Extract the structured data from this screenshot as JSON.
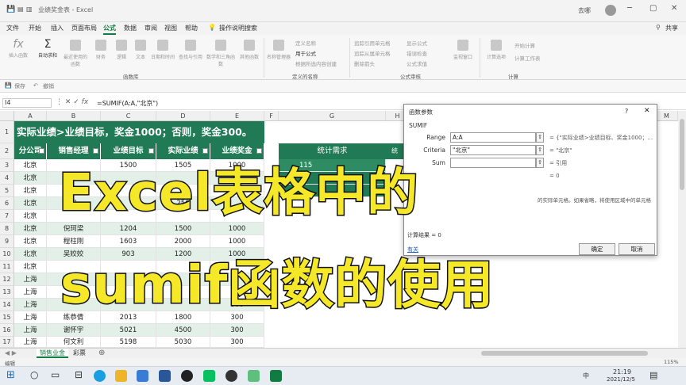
{
  "titlebar": {
    "save": "💾",
    "undo": "↶",
    "redo": "↷",
    "title": "业绩奖金表 - Excel",
    "user": "去哪",
    "minimize": "─",
    "restore": "▢",
    "close": "✕"
  },
  "menu": [
    "文件",
    "开始",
    "插入",
    "页面布局",
    "公式",
    "数据",
    "审阅",
    "视图",
    "帮助",
    "操作说明搜索"
  ],
  "share": "共享",
  "ribbon": {
    "insert_fn": "插入函数",
    "autosum": "自动求和",
    "recent": "最近使用的函数",
    "finance": "财务",
    "logic": "逻辑",
    "text": "文本",
    "datetime": "日期和时间",
    "lookup": "查找与引用",
    "math": "数学和三角函数",
    "other": "其他函数",
    "lib_label": "函数库",
    "name_mgr": "名称管理器",
    "define_name": "定义名称",
    "use_formula": "用于公式",
    "create_sel": "根据所选内容创建",
    "names_label": "定义的名称",
    "trace_prec": "追踪引用单元格",
    "trace_dep": "追踪从属单元格",
    "remove_arrows": "删除箭头",
    "show_formula": "显示公式",
    "error_check": "错误检查",
    "eval_formula": "公式求值",
    "watch": "监视窗口",
    "audit_label": "公式审核",
    "calc_now": "开始计算",
    "calc_sheet": "计算工作表",
    "calc_opt": "计算选项",
    "calc_label": "计算"
  },
  "qbar": {
    "save": "保存",
    "undo": "撤销"
  },
  "namebox": "I4",
  "formula": "=SUMIF(A:A,\"北京\")",
  "columns": [
    "A",
    "B",
    "C",
    "D",
    "E",
    "F",
    "G",
    "H",
    "I",
    "J",
    "K",
    "L",
    "M"
  ],
  "rows": [
    "1",
    "2",
    "3",
    "4",
    "5",
    "6",
    "7",
    "8",
    "9",
    "10",
    "11",
    "12",
    "13",
    "14",
    "15",
    "16",
    "17"
  ],
  "banner": "实际业绩>业绩目标，奖金1000；否则，奖金300。",
  "headers": [
    "分公司",
    "销售经理",
    "业绩目标",
    "实际业绩",
    "业绩奖金"
  ],
  "table": [
    [
      "北京",
      "",
      "1500",
      "1505",
      "1000"
    ],
    [
      "北京",
      "",
      "",
      "",
      ""
    ],
    [
      "北京",
      "",
      "",
      "",
      ""
    ],
    [
      "北京",
      "刀",
      "",
      "250",
      ""
    ],
    [
      "北京",
      "",
      "",
      "",
      ""
    ],
    [
      "北京",
      "倪珂梁",
      "1204",
      "1500",
      "1000"
    ],
    [
      "北京",
      "程柱刚",
      "1603",
      "2000",
      "1000"
    ],
    [
      "北京",
      "吴姣姣",
      "903",
      "1200",
      "1000"
    ],
    [
      "北京",
      "",
      "",
      "",
      ""
    ],
    [
      "上海",
      "",
      "",
      "",
      ""
    ],
    [
      "上海",
      "",
      "",
      "",
      "300"
    ],
    [
      "上海",
      "",
      "",
      "",
      "300"
    ],
    [
      "上海",
      "练恭倩",
      "2013",
      "1800",
      "300"
    ],
    [
      "上海",
      "谢怀宇",
      "5021",
      "4500",
      "300"
    ],
    [
      "上海",
      "何文利",
      "5198",
      "5030",
      "300"
    ]
  ],
  "stat_header": "统计需求",
  "stat_cell": "115",
  "dialog": {
    "title": "函数参数",
    "help": "?",
    "close": "✕",
    "fn": "SUMIF",
    "range_label": "Range",
    "range_val": "A:A",
    "range_res": "= {\"实际业绩>业绩目标、奖金1000；...",
    "criteria_label": "Criteria",
    "criteria_val": "\"北京\"",
    "criteria_res": "= \"北京\"",
    "sum_label": "Sum",
    "sum_res": "= 引用",
    "total": "= 0",
    "desc": "的实际单元格。如果省略，将使用区域中的单元格",
    "result": "计算结果 = 0",
    "help_link": "有关",
    "ok": "确定",
    "cancel": "取消"
  },
  "overlay": {
    "line1": "Excel表格中的",
    "line2": "sumif函数的使用"
  },
  "tabs": [
    "销售业金",
    "彩票"
  ],
  "add_sheet": "⊕",
  "status": {
    "left": "编辑",
    "zoom": "115%"
  },
  "taskbar": {
    "time": "21:19",
    "date": "2021/12/5",
    "lang": "中"
  }
}
